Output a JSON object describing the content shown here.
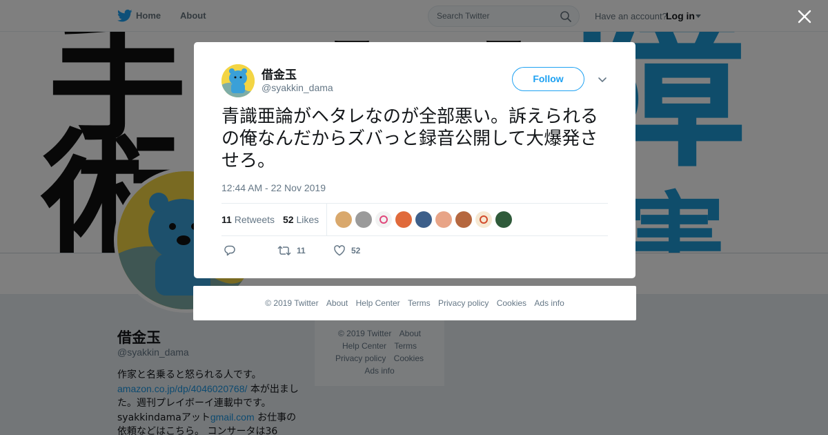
{
  "nav": {
    "home_label": "Home",
    "about_label": "About",
    "search_placeholder": "Search Twitter",
    "have_account": "Have an account?",
    "login_label": "Log in"
  },
  "profile": {
    "name": "借金玉",
    "handle": "@syakkin_dama",
    "bio_parts": [
      "作家と名乗ると怒られる人です。",
      "amazon.co.jp/dp/4046020768/",
      " 本が出ました。週刊プレイボーイ連載中です。 syakkindamaアット",
      "gmail.com",
      " お仕事の依頼などはこちら。 コンサータは36"
    ]
  },
  "side_footer": {
    "items": [
      "© 2019 Twitter",
      "About",
      "Help Center",
      "Terms",
      "Privacy policy",
      "Cookies",
      "Ads info"
    ]
  },
  "tweet": {
    "name": "借金玉",
    "handle": "@syakkin_dama",
    "follow_label": "Follow",
    "text": "青識亜論がヘタレなのが全部悪い。訴えられるの俺なんだからズバっと録音公開して大爆発させろ。",
    "timestamp": "12:44 AM - 22 Nov 2019",
    "retweets_count": "11",
    "retweets_label": "Retweets",
    "likes_count": "52",
    "likes_label": "Likes",
    "reply_count": "",
    "retweet_action_count": "11",
    "like_action_count": "52",
    "likers": [
      {
        "color": "#d9a86c"
      },
      {
        "color": "#9a9a9a"
      },
      {
        "color": "#f2f2f2",
        "accent": "#e0467a"
      },
      {
        "color": "#e06a3b"
      },
      {
        "color": "#3d5f8a"
      },
      {
        "color": "#e8a487"
      },
      {
        "color": "#b5673f"
      },
      {
        "color": "#f6e8d2",
        "accent": "#d24a2b"
      },
      {
        "color": "#2f5a3a"
      }
    ]
  },
  "modal_footer": {
    "items": [
      "© 2019 Twitter",
      "About",
      "Help Center",
      "Terms",
      "Privacy policy",
      "Cookies",
      "Ads info"
    ]
  },
  "colors": {
    "accent": "#1da1f2",
    "link": "#1b95e0",
    "banner_blue": "#1e9ad6"
  }
}
